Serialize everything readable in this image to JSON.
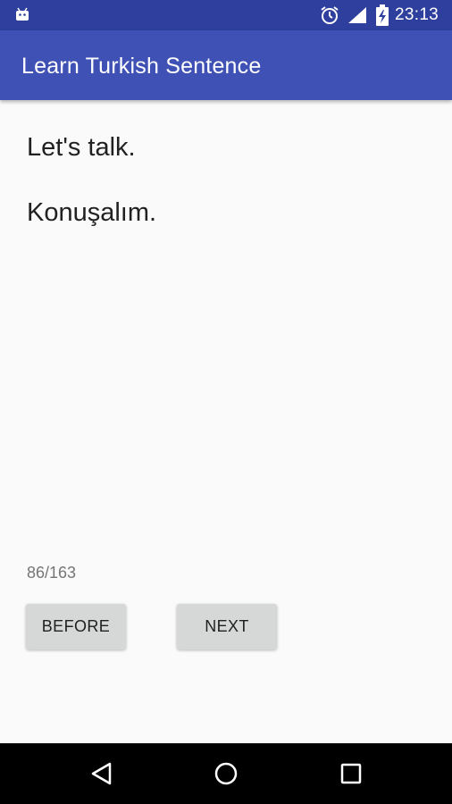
{
  "status_bar": {
    "time": "23:13",
    "icons": [
      "android-icon",
      "alarm-icon",
      "signal-icon",
      "battery-charging-icon"
    ],
    "color": "#2f3f9e"
  },
  "app_bar": {
    "title": "Learn Turkish Sentence",
    "color": "#3f51b5"
  },
  "content": {
    "sentence_english": "Let's talk.",
    "sentence_turkish": "Konuşalım.",
    "progress": "86/163"
  },
  "buttons": {
    "before_label": "BEFORE",
    "next_label": "NEXT"
  },
  "nav_bar": {
    "icons": [
      "back-icon",
      "home-icon",
      "recents-icon"
    ]
  }
}
